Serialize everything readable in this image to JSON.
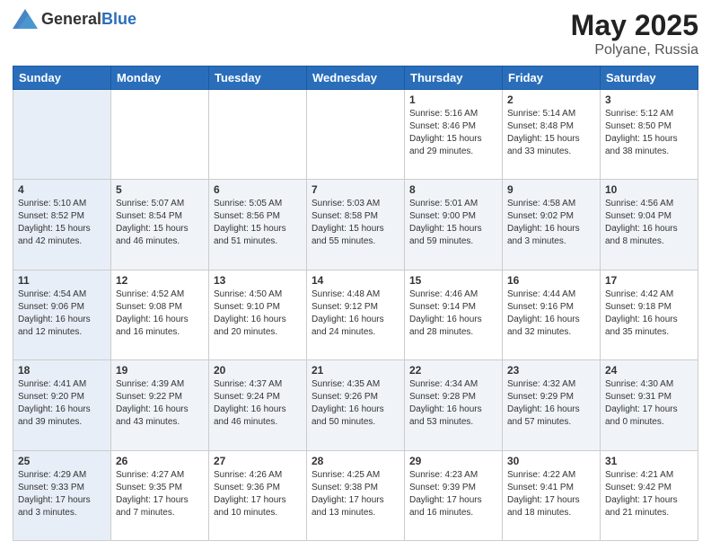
{
  "header": {
    "logo_general": "General",
    "logo_blue": "Blue",
    "title": "May 2025",
    "location": "Polyane, Russia"
  },
  "days_of_week": [
    "Sunday",
    "Monday",
    "Tuesday",
    "Wednesday",
    "Thursday",
    "Friday",
    "Saturday"
  ],
  "weeks": [
    [
      {
        "day": "",
        "info": ""
      },
      {
        "day": "",
        "info": ""
      },
      {
        "day": "",
        "info": ""
      },
      {
        "day": "",
        "info": ""
      },
      {
        "day": "1",
        "info": "Sunrise: 5:16 AM\nSunset: 8:46 PM\nDaylight: 15 hours\nand 29 minutes."
      },
      {
        "day": "2",
        "info": "Sunrise: 5:14 AM\nSunset: 8:48 PM\nDaylight: 15 hours\nand 33 minutes."
      },
      {
        "day": "3",
        "info": "Sunrise: 5:12 AM\nSunset: 8:50 PM\nDaylight: 15 hours\nand 38 minutes."
      }
    ],
    [
      {
        "day": "4",
        "info": "Sunrise: 5:10 AM\nSunset: 8:52 PM\nDaylight: 15 hours\nand 42 minutes."
      },
      {
        "day": "5",
        "info": "Sunrise: 5:07 AM\nSunset: 8:54 PM\nDaylight: 15 hours\nand 46 minutes."
      },
      {
        "day": "6",
        "info": "Sunrise: 5:05 AM\nSunset: 8:56 PM\nDaylight: 15 hours\nand 51 minutes."
      },
      {
        "day": "7",
        "info": "Sunrise: 5:03 AM\nSunset: 8:58 PM\nDaylight: 15 hours\nand 55 minutes."
      },
      {
        "day": "8",
        "info": "Sunrise: 5:01 AM\nSunset: 9:00 PM\nDaylight: 15 hours\nand 59 minutes."
      },
      {
        "day": "9",
        "info": "Sunrise: 4:58 AM\nSunset: 9:02 PM\nDaylight: 16 hours\nand 3 minutes."
      },
      {
        "day": "10",
        "info": "Sunrise: 4:56 AM\nSunset: 9:04 PM\nDaylight: 16 hours\nand 8 minutes."
      }
    ],
    [
      {
        "day": "11",
        "info": "Sunrise: 4:54 AM\nSunset: 9:06 PM\nDaylight: 16 hours\nand 12 minutes."
      },
      {
        "day": "12",
        "info": "Sunrise: 4:52 AM\nSunset: 9:08 PM\nDaylight: 16 hours\nand 16 minutes."
      },
      {
        "day": "13",
        "info": "Sunrise: 4:50 AM\nSunset: 9:10 PM\nDaylight: 16 hours\nand 20 minutes."
      },
      {
        "day": "14",
        "info": "Sunrise: 4:48 AM\nSunset: 9:12 PM\nDaylight: 16 hours\nand 24 minutes."
      },
      {
        "day": "15",
        "info": "Sunrise: 4:46 AM\nSunset: 9:14 PM\nDaylight: 16 hours\nand 28 minutes."
      },
      {
        "day": "16",
        "info": "Sunrise: 4:44 AM\nSunset: 9:16 PM\nDaylight: 16 hours\nand 32 minutes."
      },
      {
        "day": "17",
        "info": "Sunrise: 4:42 AM\nSunset: 9:18 PM\nDaylight: 16 hours\nand 35 minutes."
      }
    ],
    [
      {
        "day": "18",
        "info": "Sunrise: 4:41 AM\nSunset: 9:20 PM\nDaylight: 16 hours\nand 39 minutes."
      },
      {
        "day": "19",
        "info": "Sunrise: 4:39 AM\nSunset: 9:22 PM\nDaylight: 16 hours\nand 43 minutes."
      },
      {
        "day": "20",
        "info": "Sunrise: 4:37 AM\nSunset: 9:24 PM\nDaylight: 16 hours\nand 46 minutes."
      },
      {
        "day": "21",
        "info": "Sunrise: 4:35 AM\nSunset: 9:26 PM\nDaylight: 16 hours\nand 50 minutes."
      },
      {
        "day": "22",
        "info": "Sunrise: 4:34 AM\nSunset: 9:28 PM\nDaylight: 16 hours\nand 53 minutes."
      },
      {
        "day": "23",
        "info": "Sunrise: 4:32 AM\nSunset: 9:29 PM\nDaylight: 16 hours\nand 57 minutes."
      },
      {
        "day": "24",
        "info": "Sunrise: 4:30 AM\nSunset: 9:31 PM\nDaylight: 17 hours\nand 0 minutes."
      }
    ],
    [
      {
        "day": "25",
        "info": "Sunrise: 4:29 AM\nSunset: 9:33 PM\nDaylight: 17 hours\nand 3 minutes."
      },
      {
        "day": "26",
        "info": "Sunrise: 4:27 AM\nSunset: 9:35 PM\nDaylight: 17 hours\nand 7 minutes."
      },
      {
        "day": "27",
        "info": "Sunrise: 4:26 AM\nSunset: 9:36 PM\nDaylight: 17 hours\nand 10 minutes."
      },
      {
        "day": "28",
        "info": "Sunrise: 4:25 AM\nSunset: 9:38 PM\nDaylight: 17 hours\nand 13 minutes."
      },
      {
        "day": "29",
        "info": "Sunrise: 4:23 AM\nSunset: 9:39 PM\nDaylight: 17 hours\nand 16 minutes."
      },
      {
        "day": "30",
        "info": "Sunrise: 4:22 AM\nSunset: 9:41 PM\nDaylight: 17 hours\nand 18 minutes."
      },
      {
        "day": "31",
        "info": "Sunrise: 4:21 AM\nSunset: 9:42 PM\nDaylight: 17 hours\nand 21 minutes."
      }
    ]
  ]
}
